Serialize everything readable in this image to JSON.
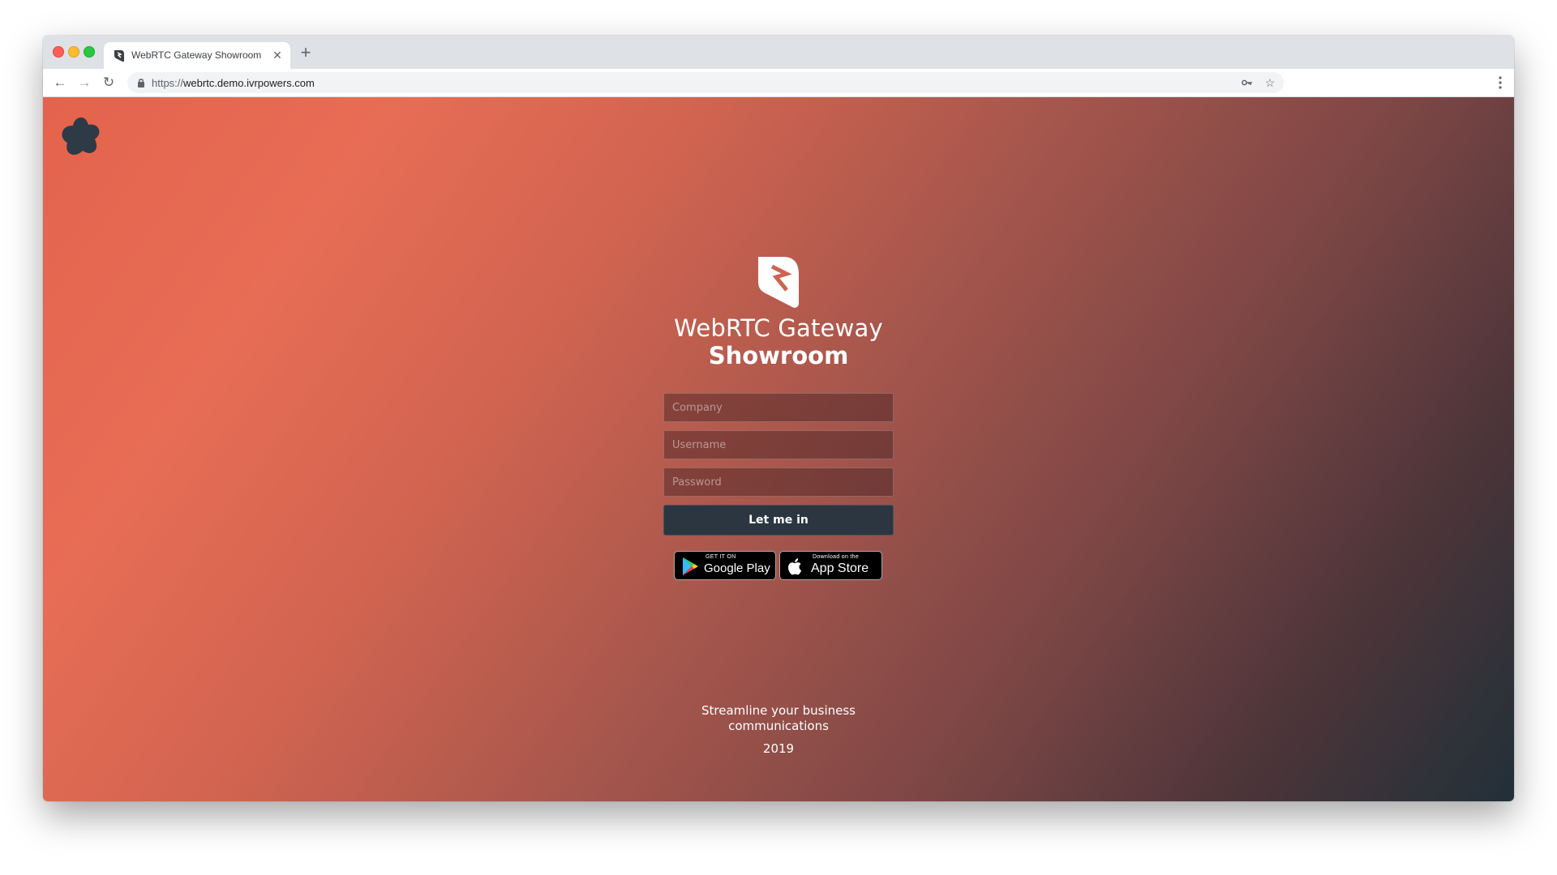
{
  "browser": {
    "tab": {
      "title": "WebRTC Gateway Showroom",
      "close_icon": "close-icon",
      "favicon": "gateway-logo-icon"
    },
    "new_tab_icon": "plus-icon",
    "toolbar": {
      "back_icon": "arrow-left-icon",
      "forward_icon": "arrow-right-icon",
      "reload_icon": "reload-icon",
      "lock_icon": "lock-icon",
      "url_scheme": "https://",
      "url_host": "webrtc.demo.ivrpowers.com",
      "key_icon": "key-icon",
      "bookmark_icon": "star-icon",
      "menu_icon": "more-vertical-icon"
    }
  },
  "page": {
    "corner_logo": "flower-logo-icon",
    "app_logo": "gateway-logo-icon",
    "title_line1": "WebRTC Gateway",
    "title_line2": "Showroom",
    "form": {
      "company_placeholder": "Company",
      "username_placeholder": "Username",
      "password_placeholder": "Password",
      "submit_label": "Let me in"
    },
    "stores": {
      "google_small": "GET IT ON",
      "google_big": "Google Play",
      "apple_small": "Download on the",
      "apple_big": "App Store"
    },
    "tagline_line1": "Streamline your business",
    "tagline_line2": "communications",
    "year": "2019"
  },
  "colors": {
    "gradient_start": "#e3634d",
    "gradient_end": "#213039",
    "button_bg": "#2b3641",
    "logo_dark": "#2e3a45"
  }
}
